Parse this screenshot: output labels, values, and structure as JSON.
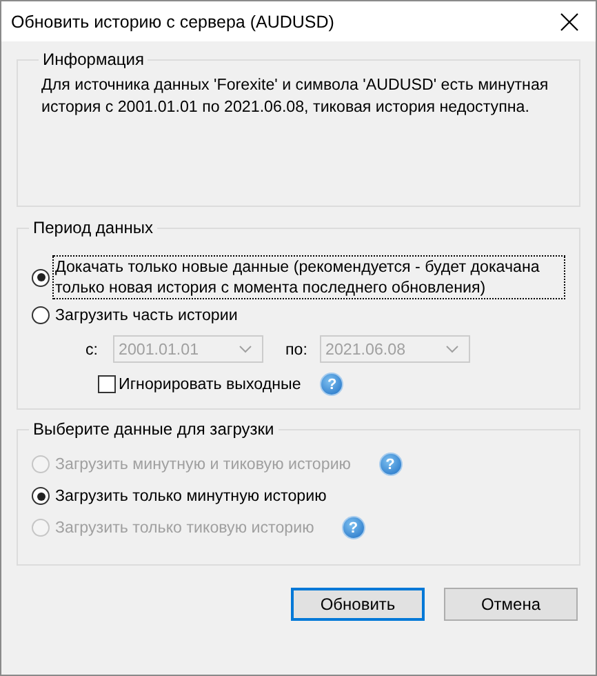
{
  "window": {
    "title": "Обновить историю с сервера (AUDUSD)"
  },
  "info": {
    "title": "Информация",
    "text": "Для источника данных 'Forexite' и символа 'AUDUSD' есть минутная история с 2001.01.01 по 2021.06.08, тиковая история недоступна."
  },
  "period": {
    "title": "Период данных",
    "options": [
      {
        "label": "Докачать только новые данные (рекомендуется - будет докачана только новая история с момента последнего обновления)",
        "selected": true,
        "focused": true
      },
      {
        "label": "Загрузить часть истории",
        "selected": false,
        "focused": false
      }
    ],
    "from": {
      "label": "с:",
      "value": "2001.01.01",
      "disabled": true
    },
    "to": {
      "label": "по:",
      "value": "2021.06.08",
      "disabled": true
    },
    "ignore_weekends": {
      "label": "Игнорировать выходные",
      "checked": false,
      "help": "?"
    }
  },
  "data": {
    "title": "Выберите данные для загрузки",
    "options": [
      {
        "label": "Загрузить минутную и тиковую историю",
        "selected": false,
        "disabled": true,
        "help": "?"
      },
      {
        "label": "Загрузить только минутную историю",
        "selected": true,
        "disabled": false
      },
      {
        "label": "Загрузить только тиковую историю",
        "selected": false,
        "disabled": true,
        "help": "?"
      }
    ]
  },
  "buttons": [
    {
      "label": "Обновить",
      "default": true
    },
    {
      "label": "Отмена",
      "default": false
    }
  ]
}
